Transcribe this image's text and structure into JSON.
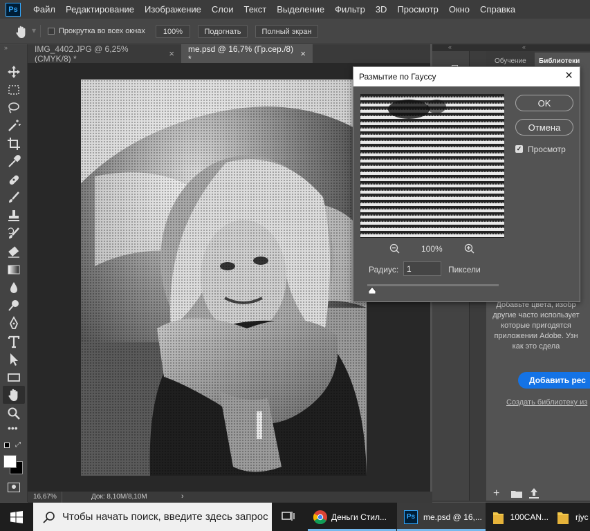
{
  "app": {
    "logo": "Ps"
  },
  "menu": [
    "Файл",
    "Редактирование",
    "Изображение",
    "Слои",
    "Текст",
    "Выделение",
    "Фильтр",
    "3D",
    "Просмотр",
    "Окно",
    "Справка"
  ],
  "options": {
    "scroll_all_label": "Прокрутка во всех окнах",
    "zoom_100": "100%",
    "fit": "Подогнать",
    "fullscreen": "Полный экран"
  },
  "tabs": [
    {
      "label": "IMG_4402.JPG @ 6,25% (CMYK/8) *"
    },
    {
      "label": "me.psd @ 16,7% (Гр.сер./8) *"
    }
  ],
  "status": {
    "zoom": "16,67%",
    "doc": "Док: 8,10M/8,10M"
  },
  "right_panel": {
    "tab_learn": "Обучение",
    "tab_libraries": "Библиотеки",
    "desc": [
      "Добавьте цвета, изобр",
      "другие часто использует",
      "которые пригодятся",
      "приложении Adobe. Узн",
      "как это сдела"
    ],
    "add_button": "Добавить рес",
    "create_link": "Создать библиотеку из"
  },
  "dialog": {
    "title": "Размытие по Гауссу",
    "ok": "OK",
    "cancel": "Отмена",
    "preview_label": "Просмотр",
    "preview_checked": true,
    "zoom": "100%",
    "radius_label": "Радиус:",
    "radius_value": "1",
    "radius_unit": "Пиксели"
  },
  "taskbar": {
    "search_placeholder": "Чтобы начать поиск, введите здесь запрос",
    "items": [
      "Деньги Стил...",
      "me.psd @ 16,...",
      "100CAN...",
      "rjyc"
    ]
  }
}
